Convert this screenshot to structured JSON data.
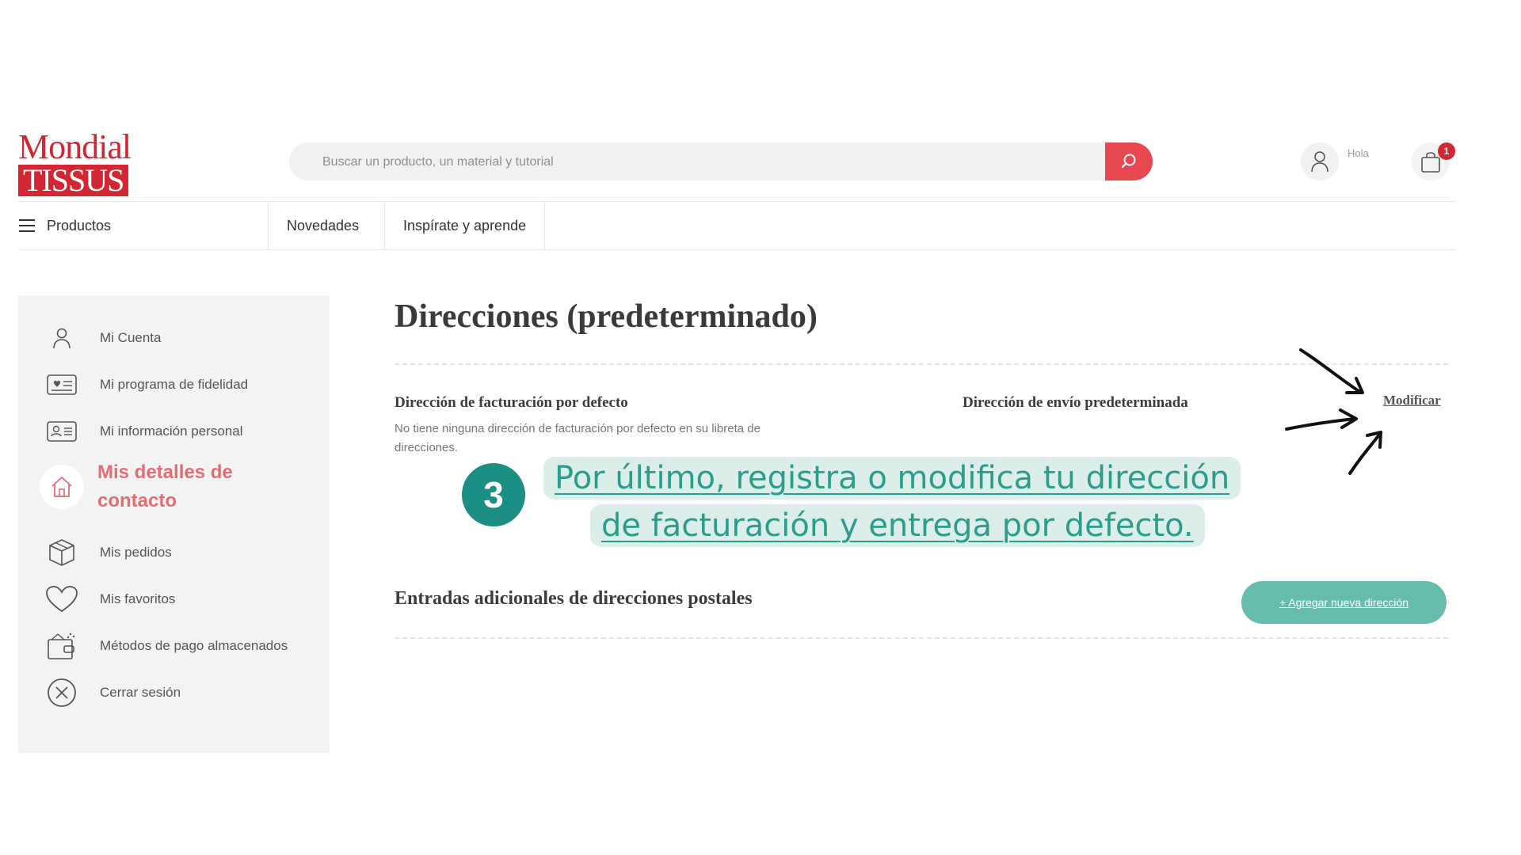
{
  "brand": {
    "line1": "Mondial",
    "line2": "TISSUS",
    "color": "#d22632"
  },
  "search": {
    "placeholder": "Buscar un producto, un material y tutorial",
    "button_color": "#e7474f"
  },
  "header": {
    "greeting": "Hola",
    "cart_count": "1"
  },
  "nav": {
    "products": "Productos",
    "items": [
      "Novedades",
      "Inspírate y aprende"
    ]
  },
  "sidebar": {
    "items": [
      {
        "label": "Mi Cuenta",
        "icon": "user-icon"
      },
      {
        "label": "Mi programa de fidelidad",
        "icon": "loyalty-card-icon"
      },
      {
        "label": "Mi información personal",
        "icon": "id-card-icon"
      },
      {
        "label": "Mis detalles de contacto",
        "icon": "home-icon",
        "active": true
      },
      {
        "label": "Mis pedidos",
        "icon": "box-icon"
      },
      {
        "label": "Mis favoritos",
        "icon": "heart-icon"
      },
      {
        "label": "Métodos de pago almacenados",
        "icon": "wallet-icon"
      },
      {
        "label": "Cerrar sesión",
        "icon": "close-circle-icon"
      }
    ],
    "active_color": "#e26d75"
  },
  "main": {
    "title": "Direcciones (predeterminado)",
    "billing_heading": "Dirección de facturación por defecto",
    "billing_text": "No tiene ninguna dirección de facturación por defecto en su libreta de direcciones.",
    "shipping_heading": "Dirección de envío predeterminada",
    "modify_link": "Modificar",
    "postal_heading": "Entradas adicionales de direcciones postales",
    "add_button": "+ Agregar nueva dirección",
    "add_button_color": "#66bcad"
  },
  "tutorial": {
    "step": "3",
    "line1": "Por último, registra o modifica tu dirección",
    "line2": "de facturación y entrega por defecto.",
    "accent": "#1c8f85",
    "text_color": "#2a9d8c"
  }
}
